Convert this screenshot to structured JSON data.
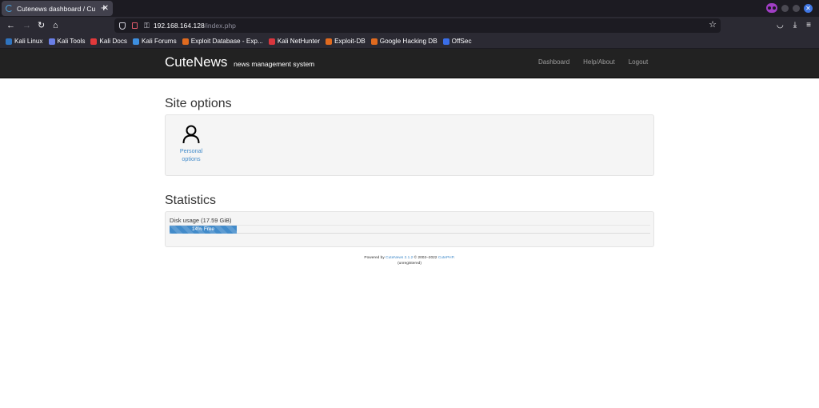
{
  "browser": {
    "tab_title": "Cutenews dashboard / Cu",
    "tab_close": "✕",
    "new_tab": "+",
    "url_host": "192.168.164.128",
    "url_path": "/index.php",
    "bookmarks": [
      {
        "label": "Kali Linux",
        "icon": "kali-linux-icon",
        "color": "#2f74c0"
      },
      {
        "label": "Kali Tools",
        "icon": "kali-tools-icon",
        "color": "#6a7fe8"
      },
      {
        "label": "Kali Docs",
        "icon": "kali-docs-icon",
        "color": "#e2393b"
      },
      {
        "label": "Kali Forums",
        "icon": "kali-forums-icon",
        "color": "#3d8fe0"
      },
      {
        "label": "Exploit Database - Exp...",
        "icon": "exploit-db-icon",
        "color": "#e06a1f"
      },
      {
        "label": "Kali NetHunter",
        "icon": "kali-nethunter-icon",
        "color": "#d9363e"
      },
      {
        "label": "Exploit-DB",
        "icon": "exploit-db-icon",
        "color": "#e06a1f"
      },
      {
        "label": "Google Hacking DB",
        "icon": "google-hacking-db-icon",
        "color": "#e06a1f"
      },
      {
        "label": "OffSec",
        "icon": "offsec-icon",
        "color": "#3a6ee8"
      }
    ]
  },
  "header": {
    "brand": "CuteNews",
    "brand_sub": "news management system",
    "links": [
      "Dashboard",
      "Help/About",
      "Logout"
    ]
  },
  "site_options": {
    "title": "Site options",
    "items": [
      {
        "label_line1": "Personal",
        "label_line2": "options",
        "icon": "user-icon"
      }
    ]
  },
  "statistics": {
    "title": "Statistics",
    "disk_label": "Disk usage (17.59 GiB)",
    "progress_text": "14% Free",
    "progress_fraction": 0.14
  },
  "footer": {
    "powered_by": "Powered by",
    "product_link": "CuteNews 2.1.2",
    "copyright": "© 2002–2022",
    "company_link": "CutePHP",
    "period": ".",
    "license": "(unregistered)"
  }
}
